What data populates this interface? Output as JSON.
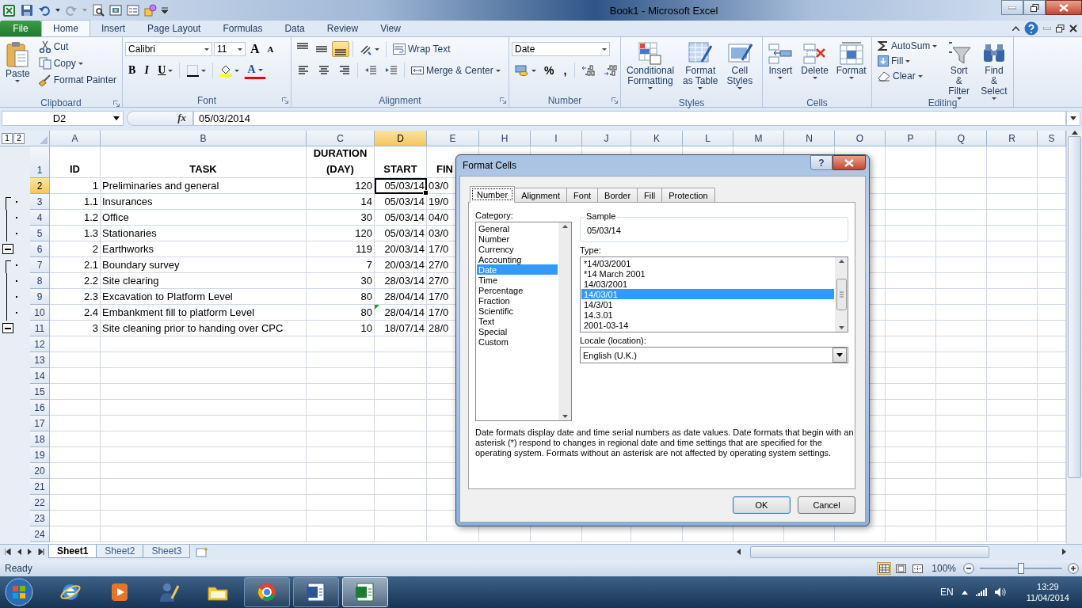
{
  "title_bar": {
    "title": "Book1  -  Microsoft Excel"
  },
  "ribbon_tabs": [
    {
      "label": "File",
      "kind": "file",
      "selected": false
    },
    {
      "label": "Home",
      "kind": "tab",
      "selected": true
    },
    {
      "label": "Insert",
      "kind": "tab",
      "selected": false
    },
    {
      "label": "Page Layout",
      "kind": "tab",
      "selected": false
    },
    {
      "label": "Formulas",
      "kind": "tab",
      "selected": false
    },
    {
      "label": "Data",
      "kind": "tab",
      "selected": false
    },
    {
      "label": "Review",
      "kind": "tab",
      "selected": false
    },
    {
      "label": "View",
      "kind": "tab",
      "selected": false
    }
  ],
  "clipboard": {
    "label": "Clipboard",
    "paste": "Paste",
    "cut": "Cut",
    "copy": "Copy",
    "format_painter": "Format Painter"
  },
  "font": {
    "label": "Font",
    "font_name": "Calibri",
    "font_size": "11",
    "grow": "A",
    "shrink": "A",
    "bold": "B",
    "italic": "I",
    "underline": "U",
    "font_color": "A"
  },
  "alignment": {
    "label": "Alignment",
    "vertical": [
      {
        "selected": false
      },
      {
        "selected": false
      },
      {
        "selected": true
      }
    ],
    "wrap_text": "Wrap Text",
    "merge_center": "Merge & Center"
  },
  "number": {
    "label": "Number",
    "format": "Date",
    "percent": "%",
    "comma": ","
  },
  "styles": {
    "label": "Styles",
    "buttons": [
      "Conditional\nFormatting",
      "Format\nas Table",
      "Cell\nStyles"
    ]
  },
  "cells": {
    "label": "Cells",
    "buttons": [
      "Insert",
      "Delete",
      "Format"
    ]
  },
  "editing": {
    "label": "Editing",
    "autosum": "AutoSum",
    "fill": "Fill",
    "clear": "Clear",
    "sort_filter": "Sort &\nFilter",
    "find_select": "Find &\nSelect"
  },
  "formula_bar": {
    "name_box": "D2",
    "function_label": "fx",
    "formula": "05/03/2014"
  },
  "outline_levels": [
    "1",
    "2"
  ],
  "columns": [
    {
      "label": "A",
      "selected": false
    },
    {
      "label": "B",
      "selected": false
    },
    {
      "label": "C",
      "selected": false
    },
    {
      "label": "D",
      "selected": true
    },
    {
      "label": "E",
      "selected": false
    },
    {
      "label": "H",
      "selected": false
    },
    {
      "label": "I",
      "selected": false
    },
    {
      "label": "J",
      "selected": false
    },
    {
      "label": "K",
      "selected": false
    },
    {
      "label": "L",
      "selected": false
    },
    {
      "label": "M",
      "selected": false
    },
    {
      "label": "N",
      "selected": false
    },
    {
      "label": "O",
      "selected": false
    },
    {
      "label": "P",
      "selected": false
    },
    {
      "label": "Q",
      "selected": false
    },
    {
      "label": "R",
      "selected": false
    },
    {
      "label": "S",
      "selected": false
    }
  ],
  "rows": [
    {
      "number": "1",
      "selected": false,
      "kind": "header",
      "grouped": false,
      "group_end": false,
      "cells": [
        "ID",
        "TASK",
        "DURATION\n(DAY)",
        "START",
        "FIN"
      ]
    },
    {
      "number": "2",
      "selected": true,
      "kind": "data",
      "grouped": false,
      "group_end": false,
      "flag": false,
      "cells": [
        "1",
        "Preliminaries and general",
        "120",
        "05/03/14",
        "03/0"
      ]
    },
    {
      "number": "3",
      "selected": false,
      "kind": "data",
      "grouped": true,
      "group_end": false,
      "flag": false,
      "cells": [
        "1.1",
        "Insurances",
        "14",
        "05/03/14",
        "19/0"
      ]
    },
    {
      "number": "4",
      "selected": false,
      "kind": "data",
      "grouped": true,
      "group_end": false,
      "flag": false,
      "cells": [
        "1.2",
        "Office",
        "30",
        "05/03/14",
        "04/0"
      ]
    },
    {
      "number": "5",
      "selected": false,
      "kind": "data",
      "grouped": true,
      "group_end": false,
      "flag": false,
      "cells": [
        "1.3",
        "Stationaries",
        "120",
        "05/03/14",
        "03/0"
      ]
    },
    {
      "number": "6",
      "selected": false,
      "kind": "data",
      "grouped": false,
      "group_end": true,
      "flag": false,
      "cells": [
        "2",
        "Earthworks",
        "119",
        "20/03/14",
        "17/0"
      ]
    },
    {
      "number": "7",
      "selected": false,
      "kind": "data",
      "grouped": true,
      "group_end": false,
      "flag": false,
      "cells": [
        "2.1",
        "Boundary survey",
        "7",
        "20/03/14",
        "27/0"
      ]
    },
    {
      "number": "8",
      "selected": false,
      "kind": "data",
      "grouped": true,
      "group_end": false,
      "flag": false,
      "cells": [
        "2.2",
        "Site clearing",
        "30",
        "28/03/14",
        "27/0"
      ]
    },
    {
      "number": "9",
      "selected": false,
      "kind": "data",
      "grouped": true,
      "group_end": false,
      "flag": false,
      "cells": [
        "2.3",
        "Excavation to Platform Level",
        "80",
        "28/04/14",
        "17/0"
      ]
    },
    {
      "number": "10",
      "selected": false,
      "kind": "data",
      "grouped": true,
      "group_end": false,
      "flag": true,
      "cells": [
        "2.4",
        "Embankment fill to platform Level",
        "80",
        "28/04/14",
        "17/0"
      ]
    },
    {
      "number": "11",
      "selected": false,
      "kind": "data",
      "grouped": false,
      "group_end": true,
      "flag": false,
      "cells": [
        "3",
        "Site cleaning prior to handing over CPC",
        "10",
        "18/07/14",
        "28/0"
      ]
    },
    {
      "number": "12",
      "selected": false,
      "kind": "empty"
    },
    {
      "number": "13",
      "selected": false,
      "kind": "empty"
    },
    {
      "number": "14",
      "selected": false,
      "kind": "empty"
    },
    {
      "number": "15",
      "selected": false,
      "kind": "empty"
    },
    {
      "number": "16",
      "selected": false,
      "kind": "empty"
    },
    {
      "number": "17",
      "selected": false,
      "kind": "empty"
    },
    {
      "number": "18",
      "selected": false,
      "kind": "empty"
    },
    {
      "number": "19",
      "selected": false,
      "kind": "empty"
    },
    {
      "number": "20",
      "selected": false,
      "kind": "empty"
    },
    {
      "number": "21",
      "selected": false,
      "kind": "empty"
    },
    {
      "number": "22",
      "selected": false,
      "kind": "empty"
    },
    {
      "number": "23",
      "selected": false,
      "kind": "empty"
    },
    {
      "number": "24",
      "selected": false,
      "kind": "empty"
    }
  ],
  "sheet_tabs": [
    {
      "label": "Sheet1",
      "selected": true
    },
    {
      "label": "Sheet2",
      "selected": false
    },
    {
      "label": "Sheet3",
      "selected": false
    }
  ],
  "status_bar": {
    "status": "Ready",
    "views": [
      {
        "selected": true
      },
      {
        "selected": false
      },
      {
        "selected": false
      }
    ],
    "zoom": "100%",
    "zoom_slider": {
      "level": 0.5
    }
  },
  "taskbar": {
    "apps": [
      {
        "running": false,
        "active": false
      },
      {
        "running": false,
        "active": false
      },
      {
        "running": false,
        "active": false
      },
      {
        "running": false,
        "active": false
      },
      {
        "running": true,
        "active": false
      },
      {
        "running": true,
        "active": false
      },
      {
        "running": true,
        "active": true
      }
    ],
    "language": "EN",
    "time": "13:29",
    "date": "11/04/2014"
  },
  "dialog": {
    "title": "Format Cells",
    "help": "?",
    "tabs": [
      {
        "label": "Number",
        "selected": true
      },
      {
        "label": "Alignment",
        "selected": false
      },
      {
        "label": "Font",
        "selected": false
      },
      {
        "label": "Border",
        "selected": false
      },
      {
        "label": "Fill",
        "selected": false
      },
      {
        "label": "Protection",
        "selected": false
      }
    ],
    "category_label": "Category:",
    "categories": [
      {
        "label": "General",
        "selected": false
      },
      {
        "label": "Number",
        "selected": false
      },
      {
        "label": "Currency",
        "selected": false
      },
      {
        "label": "Accounting",
        "selected": false
      },
      {
        "label": "Date",
        "selected": true
      },
      {
        "label": "Time",
        "selected": false
      },
      {
        "label": "Percentage",
        "selected": false
      },
      {
        "label": "Fraction",
        "selected": false
      },
      {
        "label": "Scientific",
        "selected": false
      },
      {
        "label": "Text",
        "selected": false
      },
      {
        "label": "Special",
        "selected": false
      },
      {
        "label": "Custom",
        "selected": false
      }
    ],
    "sample_label": "Sample",
    "sample": "05/03/14",
    "type_label": "Type:",
    "types": [
      {
        "label": "*14/03/2001",
        "selected": false
      },
      {
        "label": "*14 March 2001",
        "selected": false
      },
      {
        "label": "14/03/2001",
        "selected": false
      },
      {
        "label": "14/03/01",
        "selected": true
      },
      {
        "label": "14/3/01",
        "selected": false
      },
      {
        "label": "14.3.01",
        "selected": false
      },
      {
        "label": "2001-03-14",
        "selected": false
      }
    ],
    "locale_label": "Locale (location):",
    "locale": "English (U.K.)",
    "description": "Date formats display date and time serial numbers as date values.  Date formats that begin with an asterisk (*) respond to changes in regional date and time settings that are specified for the operating system. Formats without an asterisk are not affected by operating system settings.",
    "buttons": [
      {
        "label": "OK",
        "kind": "default"
      },
      {
        "label": "Cancel",
        "kind": "normal"
      }
    ]
  }
}
